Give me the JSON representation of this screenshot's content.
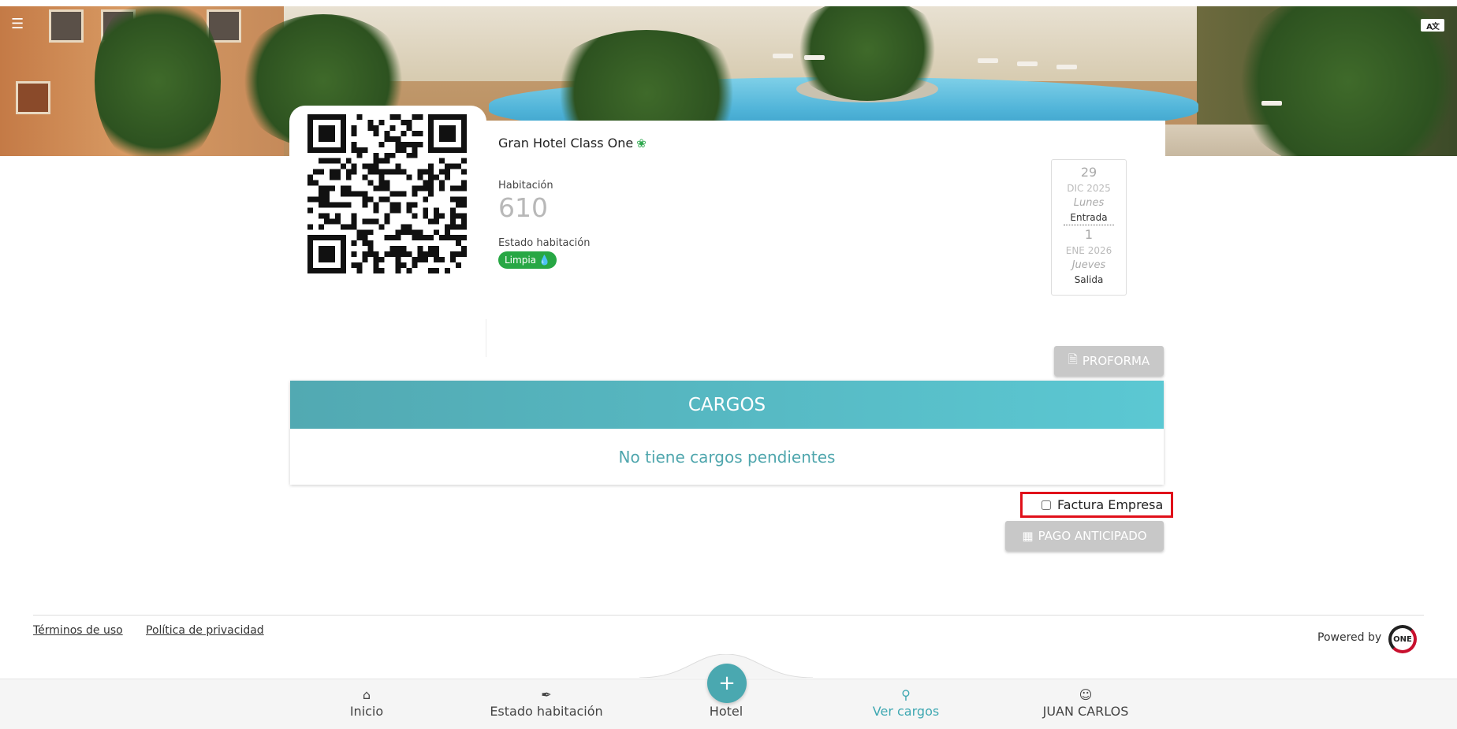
{
  "hotel": {
    "name": "Gran Hotel Class One"
  },
  "room": {
    "label": "Habitación",
    "number": "610",
    "state_label": "Estado habitación",
    "state_value": "Limpia"
  },
  "dates": {
    "checkin": {
      "day": "29",
      "month_year": "DIC 2025",
      "weekday": "Lunes",
      "label": "Entrada"
    },
    "checkout": {
      "day": "1",
      "month_year": "ENE 2026",
      "weekday": "Jueves",
      "label": "Salida"
    }
  },
  "buttons": {
    "proforma": "PROFORMA",
    "advance_payment": "PAGO ANTICIPADO"
  },
  "charges": {
    "title": "CARGOS",
    "empty_message": "No tiene cargos pendientes"
  },
  "invoice": {
    "company_label": "Factura Empresa",
    "checked": false
  },
  "footer": {
    "terms": "Términos de uso",
    "privacy": "Política de privacidad",
    "powered_by": "Powered by"
  },
  "nav": {
    "items": [
      {
        "label": "Inicio",
        "icon": "home-icon"
      },
      {
        "label": "Estado habitación",
        "icon": "brush-icon"
      },
      {
        "label": "Hotel",
        "icon": "plus-icon"
      },
      {
        "label": "Ver cargos",
        "icon": "search-icon"
      },
      {
        "label": "JUAN CARLOS",
        "icon": "user-icon"
      }
    ],
    "active": "Ver cargos"
  },
  "colors": {
    "accent": "#4aa8b0",
    "clean_badge": "#27a744",
    "highlight": "#e0101a"
  }
}
